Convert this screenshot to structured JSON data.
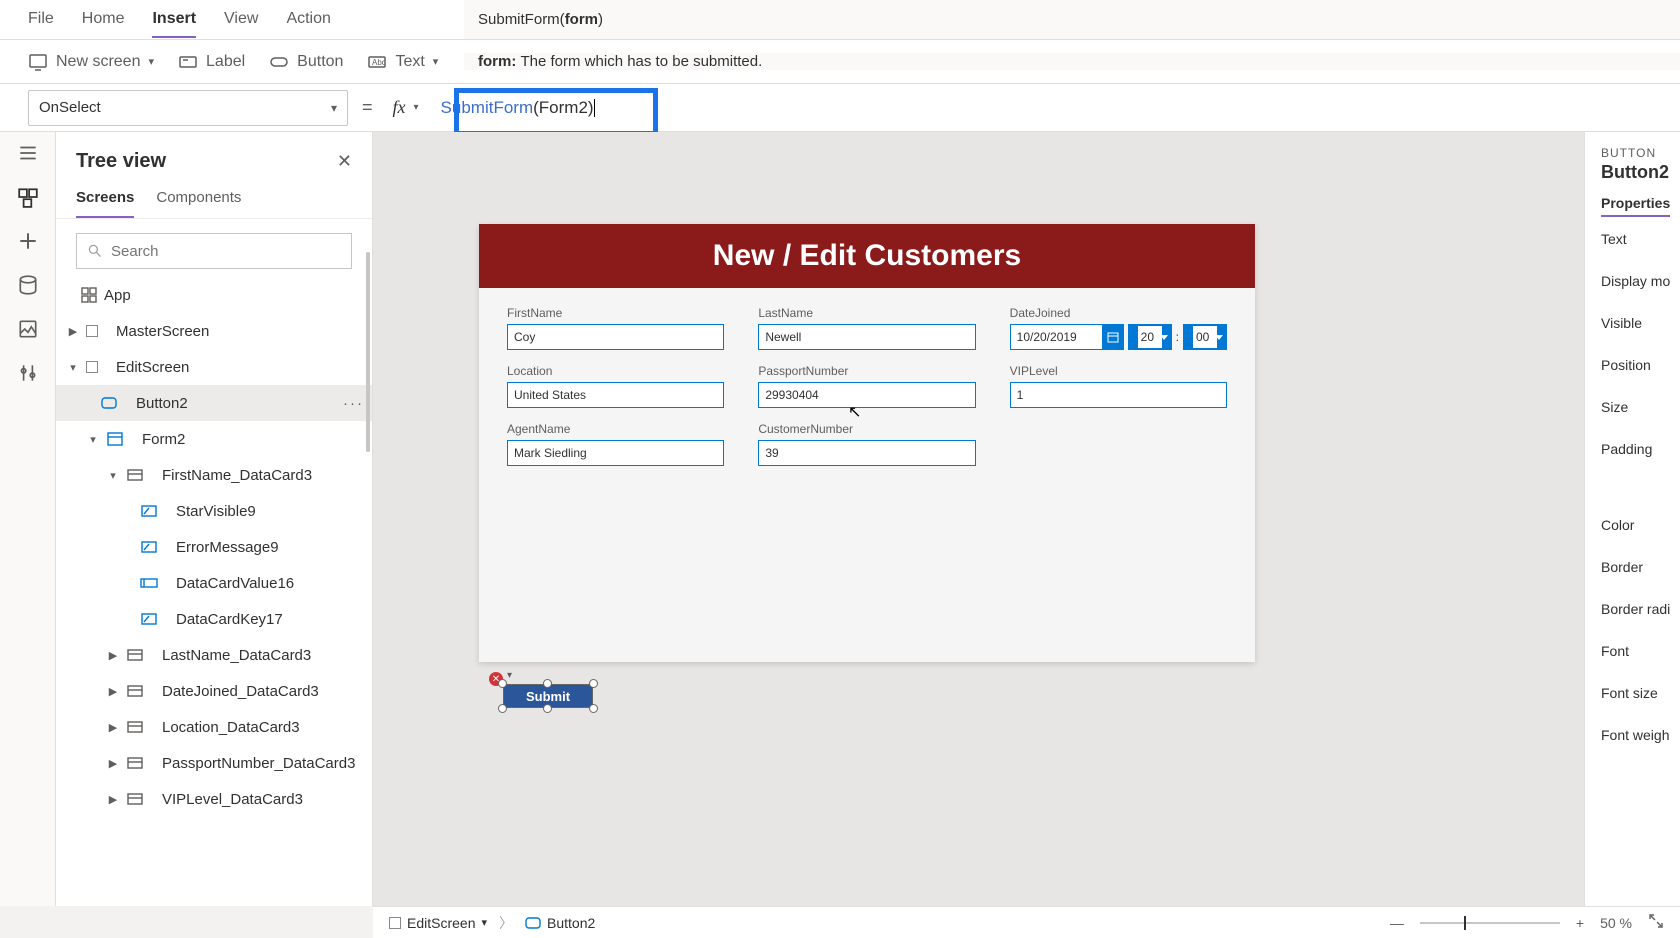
{
  "menu": {
    "file": "File",
    "home": "Home",
    "insert": "Insert",
    "view": "View",
    "action": "Action"
  },
  "hint": {
    "signature": "SubmitForm(",
    "sigbold": "form",
    "sigend": ")",
    "desc_kw": "form:",
    "desc": "The form which has to be submitted."
  },
  "ribbon": {
    "newscreen": "New screen",
    "label": "Label",
    "button": "Button",
    "text": "Text"
  },
  "formulabar": {
    "property": "OnSelect",
    "fn": "SubmitForm",
    "arg": "Form2"
  },
  "tree": {
    "title": "Tree view",
    "tab_screens": "Screens",
    "tab_components": "Components",
    "search_ph": "Search",
    "nodes": {
      "app": "App",
      "master": "MasterScreen",
      "edit": "EditScreen",
      "button2": "Button2",
      "form2": "Form2",
      "fn_dc": "FirstName_DataCard3",
      "star": "StarVisible9",
      "err": "ErrorMessage9",
      "dcv": "DataCardValue16",
      "dck": "DataCardKey17",
      "ln_dc": "LastName_DataCard3",
      "dj_dc": "DateJoined_DataCard3",
      "loc_dc": "Location_DataCard3",
      "pn_dc": "PassportNumber_DataCard3",
      "vip_dc": "VIPLevel_DataCard3"
    }
  },
  "canvas": {
    "banner": "New / Edit Customers",
    "fields": {
      "FirstName": {
        "label": "FirstName",
        "value": "Coy"
      },
      "LastName": {
        "label": "LastName",
        "value": "Newell"
      },
      "DateJoined": {
        "label": "DateJoined",
        "date": "10/20/2019",
        "hour": "20",
        "min": "00"
      },
      "Location": {
        "label": "Location",
        "value": "United States"
      },
      "PassportNumber": {
        "label": "PassportNumber",
        "value": "29930404"
      },
      "VIPLevel": {
        "label": "VIPLevel",
        "value": "1"
      },
      "AgentName": {
        "label": "AgentName",
        "value": "Mark Siedling"
      },
      "CustomerNumber": {
        "label": "CustomerNumber",
        "value": "39"
      }
    },
    "submit_label": "Submit"
  },
  "props": {
    "type": "BUTTON",
    "name": "Button2",
    "tab": "Properties",
    "rows": [
      "Text",
      "Display mo",
      "Visible",
      "Position",
      "Size",
      "Padding",
      "Color",
      "Border",
      "Border radi",
      "Font",
      "Font size",
      "Font weigh"
    ]
  },
  "breadcrumb": {
    "screen": "EditScreen",
    "ctrl": "Button2"
  },
  "status": {
    "zoom": "50",
    "pct": "%"
  }
}
